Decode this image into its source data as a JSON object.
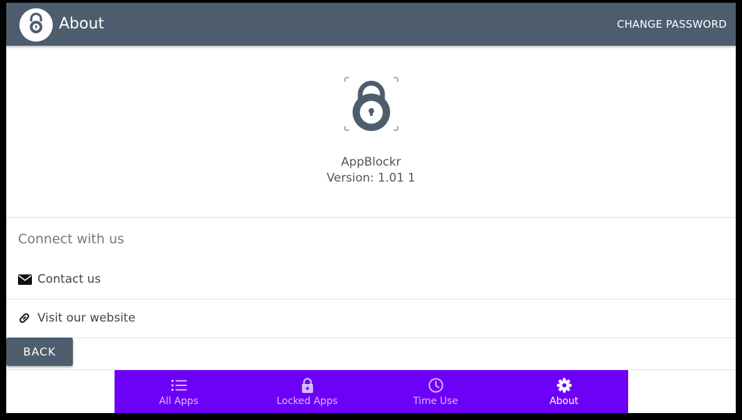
{
  "header": {
    "title": "About",
    "change_password_label": "CHANGE PASSWORD"
  },
  "about": {
    "app_name": "AppBlockr",
    "version": "Version: 1.01 1"
  },
  "connect": {
    "heading": "Connect with us",
    "items": [
      {
        "label": "Contact us",
        "icon": "envelope-icon"
      },
      {
        "label": "Visit our website",
        "icon": "link-icon"
      }
    ]
  },
  "back_label": "BACK",
  "bottom_nav": {
    "items": [
      {
        "label": "All Apps",
        "icon": "list-icon"
      },
      {
        "label": "Locked Apps",
        "icon": "lock-icon"
      },
      {
        "label": "Time Use",
        "icon": "clock-icon"
      },
      {
        "label": "About",
        "icon": "gear-icon"
      }
    ],
    "active": "About"
  },
  "colors": {
    "header": "#4e5d6e",
    "nav": "#6d01f7",
    "lock": "#4e5d6e"
  }
}
